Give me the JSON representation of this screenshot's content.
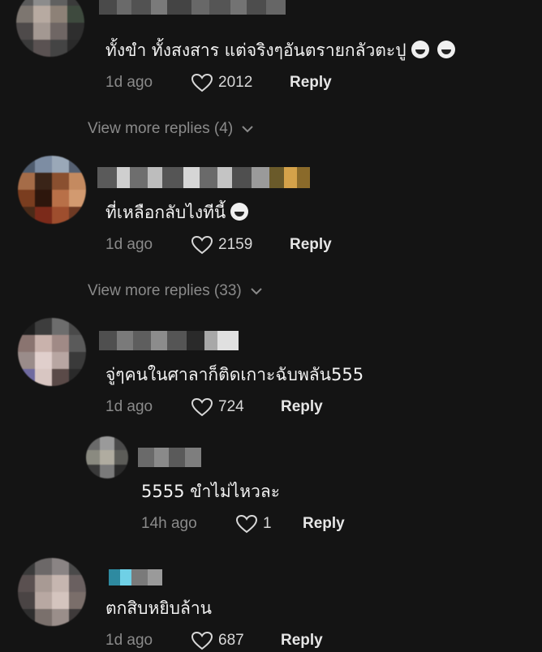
{
  "comments": [
    {
      "text": "ทั้งขำ ทั้งสงสาร แต่จริงๆอันตรายกลัวตะปู",
      "time": "1d ago",
      "likes": "2012",
      "reply_label": "Reply",
      "emojis": [
        "grin-tears-icon",
        "grin-tears-icon"
      ],
      "view_more": "View more replies (4)"
    },
    {
      "text": "ที่เหลือกลับไงทีนี้",
      "time": "1d ago",
      "likes": "2159",
      "reply_label": "Reply",
      "emojis": [
        "grin-tears-icon"
      ],
      "view_more": "View more replies (33)"
    },
    {
      "text": "จู่ๆคนในศาลาก็ติดเกาะฉับพลัน555",
      "time": "1d ago",
      "likes": "724",
      "reply_label": "Reply"
    },
    {
      "text": "5555 ขำไม่ไหวละ",
      "time": "14h ago",
      "likes": "1",
      "reply_label": "Reply",
      "is_reply": true
    },
    {
      "text": "ตกสิบหยิบล้าน",
      "time": "1d ago",
      "likes": "687",
      "reply_label": "Reply"
    }
  ],
  "colors": {
    "background": "#141414",
    "text": "#f2f2f2",
    "muted": "#8a8a8a",
    "reply": "#e6e6e6"
  },
  "icons": [
    "heart-outline-icon",
    "chevron-down-icon",
    "grin-tears-icon"
  ]
}
